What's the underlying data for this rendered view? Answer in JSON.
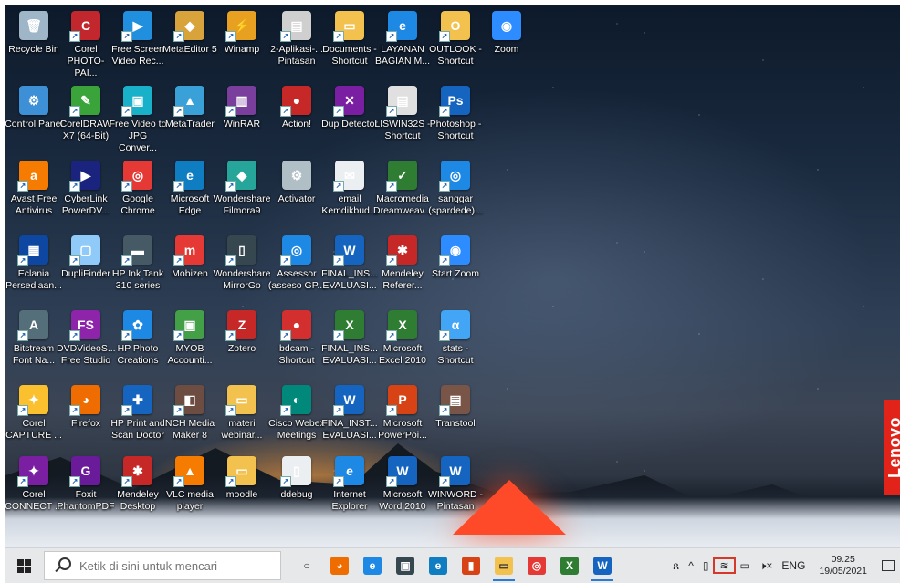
{
  "desktop": {
    "icons": [
      {
        "label": "Recycle Bin",
        "color": "#9fb5c8",
        "glyph": "🗑",
        "col": 0,
        "row": 0,
        "shortcut": false
      },
      {
        "label": "Corel PHOTO-PAI...",
        "color": "#c1272d",
        "glyph": "C",
        "col": 1,
        "row": 0,
        "shortcut": true
      },
      {
        "label": "Free Screen Video Rec...",
        "color": "#1f8fde",
        "glyph": "▶",
        "col": 2,
        "row": 0,
        "shortcut": true
      },
      {
        "label": "MetaEditor 5",
        "color": "#d8a33b",
        "glyph": "◆",
        "col": 3,
        "row": 0,
        "shortcut": true
      },
      {
        "label": "Winamp",
        "color": "#e8a020",
        "glyph": "⚡",
        "col": 4,
        "row": 0,
        "shortcut": true
      },
      {
        "label": "2-Aplikasi-... Pintasan",
        "color": "#cfcfcf",
        "glyph": "▤",
        "col": 5,
        "row": 0,
        "shortcut": true
      },
      {
        "label": "Documents - Shortcut",
        "color": "#f2c14e",
        "glyph": "▭",
        "col": 6,
        "row": 0,
        "shortcut": true
      },
      {
        "label": "LAYANAN BAGIAN M...",
        "color": "#1e88e5",
        "glyph": "e",
        "col": 7,
        "row": 0,
        "shortcut": true
      },
      {
        "label": "OUTLOOK - Shortcut",
        "color": "#f2c14e",
        "glyph": "O",
        "col": 8,
        "row": 0,
        "shortcut": true
      },
      {
        "label": "Zoom",
        "color": "#2d8cff",
        "glyph": "◉",
        "col": 9,
        "row": 0,
        "shortcut": false
      },
      {
        "label": "Control Panel",
        "color": "#3d8fd6",
        "glyph": "⚙",
        "col": 0,
        "row": 1,
        "shortcut": false
      },
      {
        "label": "CorelDRAW X7 (64-Bit)",
        "color": "#3aa33a",
        "glyph": "✎",
        "col": 1,
        "row": 1,
        "shortcut": true
      },
      {
        "label": "Free Video to JPG Conver...",
        "color": "#18b1c9",
        "glyph": "▣",
        "col": 2,
        "row": 1,
        "shortcut": true
      },
      {
        "label": "MetaTrader",
        "color": "#3aa0d8",
        "glyph": "▲",
        "col": 3,
        "row": 1,
        "shortcut": true
      },
      {
        "label": "WinRAR",
        "color": "#7a3e9d",
        "glyph": "▥",
        "col": 4,
        "row": 1,
        "shortcut": true
      },
      {
        "label": "Action!",
        "color": "#c62828",
        "glyph": "●",
        "col": 5,
        "row": 1,
        "shortcut": true
      },
      {
        "label": "Dup Detector",
        "color": "#7b1fa2",
        "glyph": "✕",
        "col": 6,
        "row": 1,
        "shortcut": true
      },
      {
        "label": "LISWIN32S - Shortcut",
        "color": "#e0e0e0",
        "glyph": "▤",
        "col": 7,
        "row": 1,
        "shortcut": true
      },
      {
        "label": "Photoshop - Shortcut",
        "color": "#1565c0",
        "glyph": "Ps",
        "col": 8,
        "row": 1,
        "shortcut": true
      },
      {
        "label": "Avast Free Antivirus",
        "color": "#f57c00",
        "glyph": "a",
        "col": 0,
        "row": 2,
        "shortcut": true
      },
      {
        "label": "CyberLink PowerDV...",
        "color": "#1a237e",
        "glyph": "▶",
        "col": 1,
        "row": 2,
        "shortcut": true
      },
      {
        "label": "Google Chrome",
        "color": "#e53935",
        "glyph": "◎",
        "col": 2,
        "row": 2,
        "shortcut": true
      },
      {
        "label": "Microsoft Edge",
        "color": "#0f7dc2",
        "glyph": "e",
        "col": 3,
        "row": 2,
        "shortcut": true
      },
      {
        "label": "Wondershare Filmora9",
        "color": "#26a69a",
        "glyph": "◆",
        "col": 4,
        "row": 2,
        "shortcut": true
      },
      {
        "label": "Activator",
        "color": "#b0bec5",
        "glyph": "⚙",
        "col": 5,
        "row": 2,
        "shortcut": false
      },
      {
        "label": "email Kemdikbud...",
        "color": "#eceff1",
        "glyph": "✉",
        "col": 6,
        "row": 2,
        "shortcut": true
      },
      {
        "label": "Macromedia Dreamweav...",
        "color": "#2e7d32",
        "glyph": "✓",
        "col": 7,
        "row": 2,
        "shortcut": true
      },
      {
        "label": "sanggar (spardede)...",
        "color": "#1e88e5",
        "glyph": "◎",
        "col": 8,
        "row": 2,
        "shortcut": true
      },
      {
        "label": "Eclania Persediaan...",
        "color": "#0d47a1",
        "glyph": "▦",
        "col": 0,
        "row": 3,
        "shortcut": true
      },
      {
        "label": "DupliFinder",
        "color": "#90caf9",
        "glyph": "▢",
        "col": 1,
        "row": 3,
        "shortcut": true
      },
      {
        "label": "HP Ink Tank 310 series",
        "color": "#455a64",
        "glyph": "▬",
        "col": 2,
        "row": 3,
        "shortcut": true
      },
      {
        "label": "Mobizen",
        "color": "#e53935",
        "glyph": "m",
        "col": 3,
        "row": 3,
        "shortcut": true
      },
      {
        "label": "Wondershare MirrorGo",
        "color": "#37474f",
        "glyph": "▯",
        "col": 4,
        "row": 3,
        "shortcut": true
      },
      {
        "label": "Assessor (asseso GP...",
        "color": "#1e88e5",
        "glyph": "◎",
        "col": 5,
        "row": 3,
        "shortcut": true
      },
      {
        "label": "FINAL_INS... EVALUASI...",
        "color": "#1565c0",
        "glyph": "W",
        "col": 6,
        "row": 3,
        "shortcut": true
      },
      {
        "label": "Mendeley Referer...",
        "color": "#c62828",
        "glyph": "✱",
        "col": 7,
        "row": 3,
        "shortcut": true
      },
      {
        "label": "Start Zoom",
        "color": "#2d8cff",
        "glyph": "◉",
        "col": 8,
        "row": 3,
        "shortcut": true
      },
      {
        "label": "Bitstream Font Na...",
        "color": "#546e7a",
        "glyph": "A",
        "col": 0,
        "row": 4,
        "shortcut": true
      },
      {
        "label": "DVDVideoS... Free Studio",
        "color": "#8e24aa",
        "glyph": "FS",
        "col": 1,
        "row": 4,
        "shortcut": true
      },
      {
        "label": "HP Photo Creations",
        "color": "#1e88e5",
        "glyph": "✿",
        "col": 2,
        "row": 4,
        "shortcut": true
      },
      {
        "label": "MYOB Accounti...",
        "color": "#43a047",
        "glyph": "▣",
        "col": 3,
        "row": 4,
        "shortcut": true
      },
      {
        "label": "Zotero",
        "color": "#c62828",
        "glyph": "Z",
        "col": 4,
        "row": 4,
        "shortcut": true
      },
      {
        "label": "bdcam - Shortcut",
        "color": "#d32f2f",
        "glyph": "●",
        "col": 5,
        "row": 4,
        "shortcut": true
      },
      {
        "label": "FINAL_INS... EVALUASI...",
        "color": "#2e7d32",
        "glyph": "X",
        "col": 6,
        "row": 4,
        "shortcut": true
      },
      {
        "label": "Microsoft Excel 2010",
        "color": "#2e7d32",
        "glyph": "X",
        "col": 7,
        "row": 4,
        "shortcut": true
      },
      {
        "label": "stats - Shortcut",
        "color": "#42a5f5",
        "glyph": "α",
        "col": 8,
        "row": 4,
        "shortcut": true
      },
      {
        "label": "Corel CAPTURE ...",
        "color": "#fbc02d",
        "glyph": "✦",
        "col": 0,
        "row": 5,
        "shortcut": true
      },
      {
        "label": "Firefox",
        "color": "#ef6c00",
        "glyph": "◕",
        "col": 1,
        "row": 5,
        "shortcut": true
      },
      {
        "label": "HP Print and Scan Doctor",
        "color": "#1565c0",
        "glyph": "✚",
        "col": 2,
        "row": 5,
        "shortcut": true
      },
      {
        "label": "NCH Media Maker 8",
        "color": "#6d4c41",
        "glyph": "◧",
        "col": 3,
        "row": 5,
        "shortcut": true
      },
      {
        "label": "materi webinar...",
        "color": "#f2c14e",
        "glyph": "▭",
        "col": 4,
        "row": 5,
        "shortcut": true
      },
      {
        "label": "Cisco Webex Meetings",
        "color": "#00897b",
        "glyph": "◐",
        "col": 5,
        "row": 5,
        "shortcut": true
      },
      {
        "label": "FINA_INST... EVALUASI...",
        "color": "#1565c0",
        "glyph": "W",
        "col": 6,
        "row": 5,
        "shortcut": true
      },
      {
        "label": "Microsoft PowerPoi...",
        "color": "#d84315",
        "glyph": "P",
        "col": 7,
        "row": 5,
        "shortcut": true
      },
      {
        "label": "Transtool",
        "color": "#795548",
        "glyph": "▤",
        "col": 8,
        "row": 5,
        "shortcut": true
      },
      {
        "label": "Corel CONNECT ...",
        "color": "#7b1fa2",
        "glyph": "✦",
        "col": 0,
        "row": 6,
        "shortcut": true
      },
      {
        "label": "Foxit PhantomPDF",
        "color": "#6a1b9a",
        "glyph": "G",
        "col": 1,
        "row": 6,
        "shortcut": true
      },
      {
        "label": "Mendeley Desktop",
        "color": "#c62828",
        "glyph": "✱",
        "col": 2,
        "row": 6,
        "shortcut": true
      },
      {
        "label": "VLC media player",
        "color": "#f57c00",
        "glyph": "▲",
        "col": 3,
        "row": 6,
        "shortcut": true
      },
      {
        "label": "moodle",
        "color": "#f2c14e",
        "glyph": "▭",
        "col": 4,
        "row": 6,
        "shortcut": true
      },
      {
        "label": "ddebug",
        "color": "#eceff1",
        "glyph": "▯",
        "col": 5,
        "row": 6,
        "shortcut": true
      },
      {
        "label": "Internet Explorer",
        "color": "#1e88e5",
        "glyph": "e",
        "col": 6,
        "row": 6,
        "shortcut": true
      },
      {
        "label": "Microsoft Word 2010",
        "color": "#1565c0",
        "glyph": "W",
        "col": 7,
        "row": 6,
        "shortcut": true
      },
      {
        "label": "WINWORD - Pintasan",
        "color": "#1565c0",
        "glyph": "W",
        "col": 8,
        "row": 6,
        "shortcut": true
      }
    ],
    "brand": "Lenovo"
  },
  "taskbar": {
    "search_placeholder": "Ketik di sini untuk mencari",
    "apps": [
      {
        "name": "cortana-icon",
        "glyph": "○",
        "color": "#e7e8ea",
        "text": "#222",
        "active": false
      },
      {
        "name": "firefox-icon",
        "glyph": "◕",
        "color": "#ef6c00",
        "text": "#fff",
        "active": false
      },
      {
        "name": "internet-explorer-icon",
        "glyph": "e",
        "color": "#1e88e5",
        "text": "#fff",
        "active": false
      },
      {
        "name": "camera-icon",
        "glyph": "▣",
        "color": "#37474f",
        "text": "#fff",
        "active": false
      },
      {
        "name": "edge-icon",
        "glyph": "e",
        "color": "#0f7dc2",
        "text": "#fff",
        "active": false
      },
      {
        "name": "office-icon",
        "glyph": "▮",
        "color": "#d84315",
        "text": "#fff",
        "active": false
      },
      {
        "name": "file-explorer-icon",
        "glyph": "▭",
        "color": "#f2c14e",
        "text": "#333",
        "active": true
      },
      {
        "name": "chrome-icon",
        "glyph": "◎",
        "color": "#e53935",
        "text": "#fff",
        "active": false
      },
      {
        "name": "excel-icon",
        "glyph": "X",
        "color": "#2e7d32",
        "text": "#fff",
        "active": false
      },
      {
        "name": "word-icon",
        "glyph": "W",
        "color": "#1565c0",
        "text": "#fff",
        "active": true
      }
    ],
    "tray": {
      "people_glyph": "ጸ",
      "chevron": "^",
      "language": "ENG",
      "time": "09.25",
      "date": "19/05/2021"
    }
  }
}
